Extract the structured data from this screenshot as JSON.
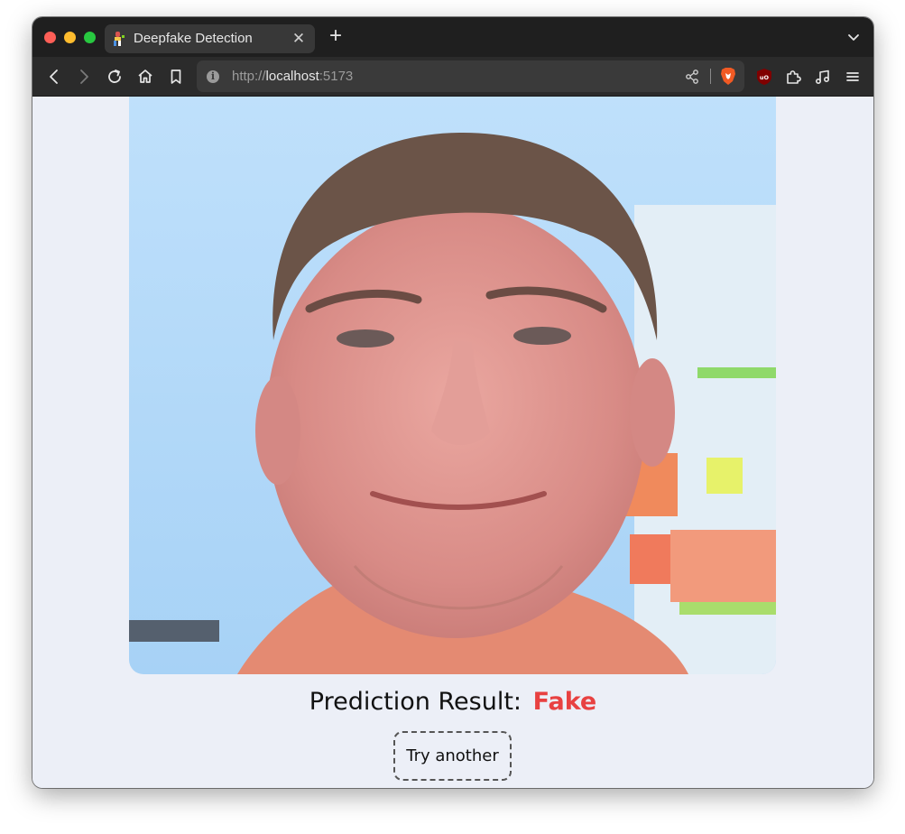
{
  "browser": {
    "tab": {
      "title": "Deepfake Detection",
      "favicon": "app-favicon",
      "close_icon": "close-icon"
    },
    "new_tab_icon": "plus-icon",
    "tab_list_icon": "chevron-down-icon",
    "nav": {
      "back_icon": "back-arrow-icon",
      "forward_icon": "forward-arrow-icon",
      "reload_icon": "reload-icon",
      "home_icon": "home-icon",
      "bookmark_icon": "bookmark-icon"
    },
    "url": {
      "scheme": "http://",
      "host": "localhost",
      "port": ":5173"
    },
    "extensions": [
      "share-icon",
      "brave-shields-icon",
      "ublock-origin-icon",
      "extensions-puzzle-icon",
      "media-music-icon",
      "menu-icon"
    ]
  },
  "page": {
    "image": {
      "subject": "face-photo"
    },
    "result": {
      "label": "Prediction Result:",
      "value": "Fake",
      "value_color": "#e84141"
    },
    "try_button": {
      "label": "Try another"
    }
  }
}
